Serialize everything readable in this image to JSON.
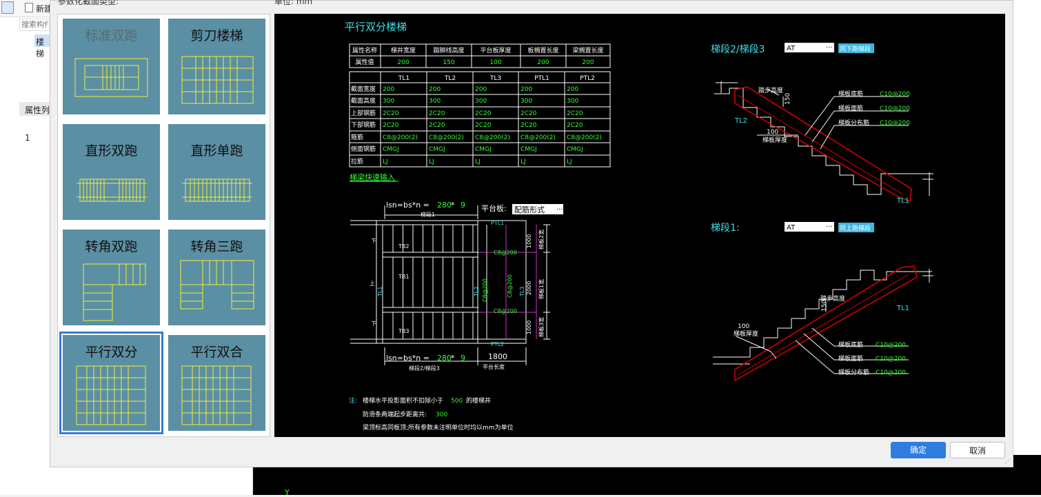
{
  "toolbar": {
    "new_label": "新建"
  },
  "sidebar": {
    "search_placeholder": "搜索构件",
    "tree_item": "楼梯",
    "props_header": "属性列",
    "row_number": "1"
  },
  "dialog": {
    "type_label": "参数化截面类型:",
    "unit_label": "单位: mm",
    "ok": "确定",
    "cancel": "取消"
  },
  "thumbnails": [
    {
      "label": "标准双跑",
      "selected": false
    },
    {
      "label": "剪刀楼梯",
      "selected": false
    },
    {
      "label": "直形双跑",
      "selected": false
    },
    {
      "label": "直形单跑",
      "selected": false
    },
    {
      "label": "转角双跑",
      "selected": false
    },
    {
      "label": "转角三跑",
      "selected": false
    },
    {
      "label": "平行双分",
      "selected": true
    },
    {
      "label": "平行双合",
      "selected": false
    }
  ],
  "preview": {
    "title": "平行双分楼梯",
    "attr_table": {
      "headers": [
        "属性名称",
        "梯井宽度",
        "踢脚线高度",
        "平台板厚度",
        "板搁置长度",
        "梁搁置长度"
      ],
      "row_label": "属性值",
      "values": [
        "200",
        "150",
        "100",
        "200",
        "200"
      ]
    },
    "beam_table": {
      "columns": [
        "TL1",
        "TL2",
        "TL3",
        "PTL1",
        "PTL2"
      ],
      "rows": [
        {
          "label": "截面宽度",
          "values": [
            "200",
            "200",
            "200",
            "200",
            "200"
          ]
        },
        {
          "label": "截面高度",
          "values": [
            "300",
            "300",
            "300",
            "300",
            "300"
          ]
        },
        {
          "label": "上部钢筋",
          "values": [
            "2C20",
            "2C20",
            "2C20",
            "2C20",
            "2C20"
          ]
        },
        {
          "label": "下部钢筋",
          "values": [
            "2C20",
            "2C20",
            "2C20",
            "2C20",
            "2C20"
          ]
        },
        {
          "label": "箍筋",
          "values": [
            "C8@200(2)",
            "C8@200(2)",
            "C8@200(2)",
            "C8@200(2)",
            "C8@200(2)"
          ]
        },
        {
          "label": "侧面钢筋",
          "values": [
            "CMGJ",
            "CMGJ",
            "CMGJ",
            "CMGJ",
            "CMGJ"
          ]
        },
        {
          "label": "拉筋",
          "values": [
            "LJ",
            "LJ",
            "LJ",
            "LJ",
            "LJ"
          ]
        }
      ]
    },
    "quick_input": "梯梁快速输入",
    "plan": {
      "formula_top": "lsn=bs*n = ",
      "n_value": "280",
      "times": " * ",
      "count": "9",
      "seg1": "梯段1",
      "platform_label": "平台板:",
      "platform_value": "配筋形式",
      "formula_bottom": "lsn=bs*n = ",
      "seg23": "梯段2/梯段3",
      "platform_len": "1800",
      "platform_len_label": "平台长度",
      "tb": [
        "TB2",
        "TB1",
        "TB3"
      ],
      "down": "下",
      "up": "上",
      "rebar1": "C8@200",
      "rebar2": "C8@200",
      "rebar3": "C8@200",
      "rebar_v": "C8@200",
      "dim1": "1000",
      "dim2": "2000",
      "dim3": "1000",
      "w1": "梯板2宽",
      "w2": "梯板1宽",
      "w3": "梯板3宽",
      "ptl1": "PTL1",
      "ptl2": "PTL2",
      "tl1": "TL1",
      "tl2": "TL2",
      "tl3": "TL3"
    },
    "notes": {
      "prefix": "注:",
      "line1a": "楼梯水平投影面积不扣除小于",
      "line1b": "500",
      "line1c": "的楼梯井",
      "line2a": "防滑条两端起步距离共:",
      "line2b": "300",
      "line3": "梁顶标高同板顶;所有参数未注明单位时均以mm为单位"
    },
    "seg23": {
      "title": "梯段2/梯段3",
      "type_value": "AT",
      "link": "同下跑梯段",
      "step_height": "踏步高度",
      "h_val": "150",
      "thick_val": "100",
      "thick_label": "梯板厚度",
      "bottom_bar": "梯板底筋",
      "top_bar": "梯板面筋",
      "dist_bar": "梯板分布筋",
      "bar1": "C10@200",
      "bar2": "C10@200",
      "bar3": "C10@200",
      "tl2": "TL2",
      "tl1": "TL1"
    },
    "seg1": {
      "title": "梯段1:",
      "type_value": "AT",
      "link": "同上跑梯段",
      "step_height": "踏步高度",
      "h_val": "150",
      "thick_val": "100",
      "thick_label": "梯板厚度",
      "bottom_bar": "梯板底筋",
      "top_bar": "梯板面筋",
      "dist_bar": "梯板分布筋",
      "bar1": "C10@200",
      "bar2": "C10@200",
      "bar3": "C10@200",
      "tl1": "TL1"
    }
  },
  "cad_axis": "Y"
}
